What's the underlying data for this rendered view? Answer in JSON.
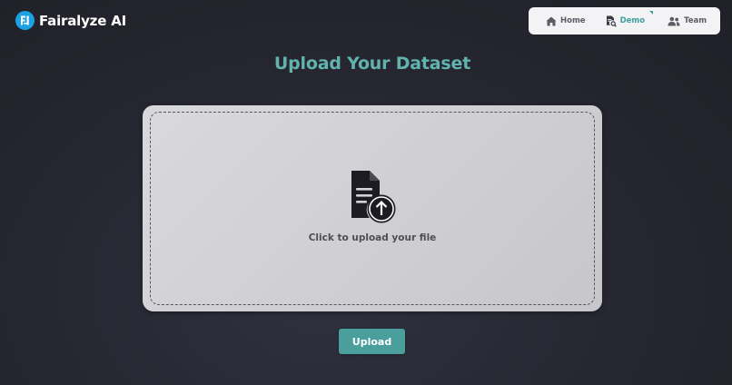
{
  "brand": {
    "name": "Fairalyze AI",
    "logo_icon": "fi-monogram-icon",
    "logo_color": "#1da1e6"
  },
  "nav": {
    "items": [
      {
        "label": "Home",
        "icon": "home-icon"
      },
      {
        "label": "Demo",
        "icon": "document-search-icon",
        "active": true
      },
      {
        "label": "Team",
        "icon": "users-icon"
      }
    ]
  },
  "page": {
    "title": "Upload Your Dataset"
  },
  "dropzone": {
    "label": "Click to upload your file",
    "icon": "file-upload-icon"
  },
  "actions": {
    "upload_label": "Upload"
  },
  "colors": {
    "accent": "#3f9f9d",
    "title": "#62b3ad",
    "button": "#4a9e9b"
  }
}
